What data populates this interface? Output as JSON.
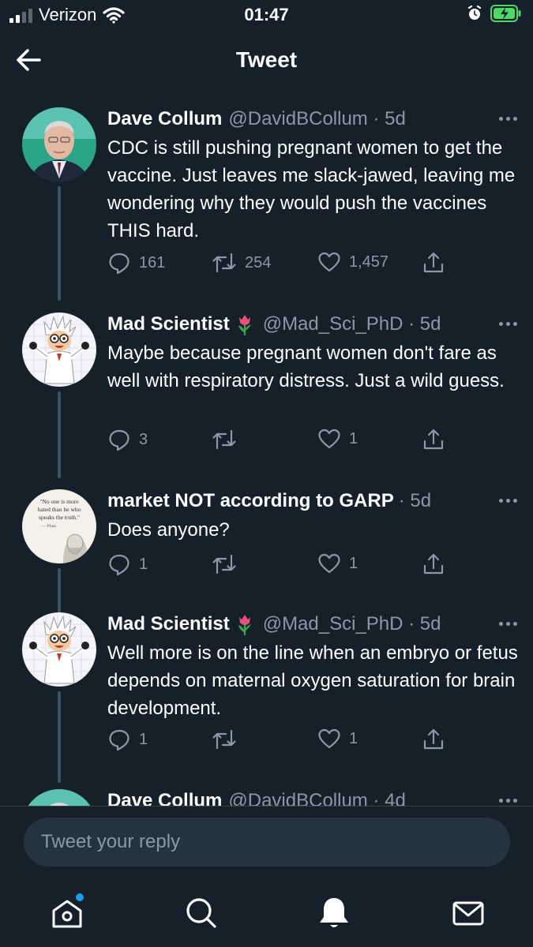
{
  "status_bar": {
    "carrier": "Verizon",
    "time": "01:47"
  },
  "header": {
    "title": "Tweet"
  },
  "tweets": [
    {
      "name": "Dave Collum",
      "handle": "@DavidBCollum · 5d",
      "text": "CDC is still pushing pregnant women to get the vaccine. Just leaves me slack-jawed, leaving me wondering why they would push the vaccines THIS hard.",
      "replies": "161",
      "retweets": "254",
      "likes": "1,457",
      "avatar": "man-in-suit-avatar"
    },
    {
      "name": "Mad Scientist",
      "emoji": "tulip",
      "handle": "@Mad_Sci_PhD · 5d",
      "text": "Maybe because pregnant women don't fare as well with respiratory distress. Just a wild guess.",
      "replies": "3",
      "retweets": "",
      "likes": "1",
      "avatar": "cartoon-scientist-avatar"
    },
    {
      "name": "market NOT according to GARP",
      "handle": "· 5d",
      "text": "Does anyone?",
      "replies": "1",
      "retweets": "",
      "likes": "1",
      "avatar": "plato-quote-avatar",
      "avatar_quote": "\"No one is more hated than he who speaks the truth.\"",
      "avatar_quote_author": "— Plato"
    },
    {
      "name": "Mad Scientist",
      "emoji": "tulip",
      "handle": "@Mad_Sci_PhD · 5d",
      "text": "Well more is on the line when an embryo or fetus depends on maternal oxygen saturation for brain development.",
      "replies": "1",
      "retweets": "",
      "likes": "1",
      "avatar": "cartoon-scientist-avatar"
    },
    {
      "name": "Dave Collum",
      "handle": "@DavidBCollum · 4d",
      "avatar": "man-in-suit-avatar"
    }
  ],
  "reply": {
    "placeholder": "Tweet your reply"
  },
  "nav": {
    "items": [
      "home-icon",
      "search-icon",
      "notifications-icon",
      "messages-icon"
    ],
    "active": "notifications-icon"
  },
  "colors": {
    "background": "#15202b",
    "secondary_text": "#8b98a5",
    "thread_line": "#3d5466",
    "accent": "#1d9bf0",
    "battery": "#4cd964"
  }
}
